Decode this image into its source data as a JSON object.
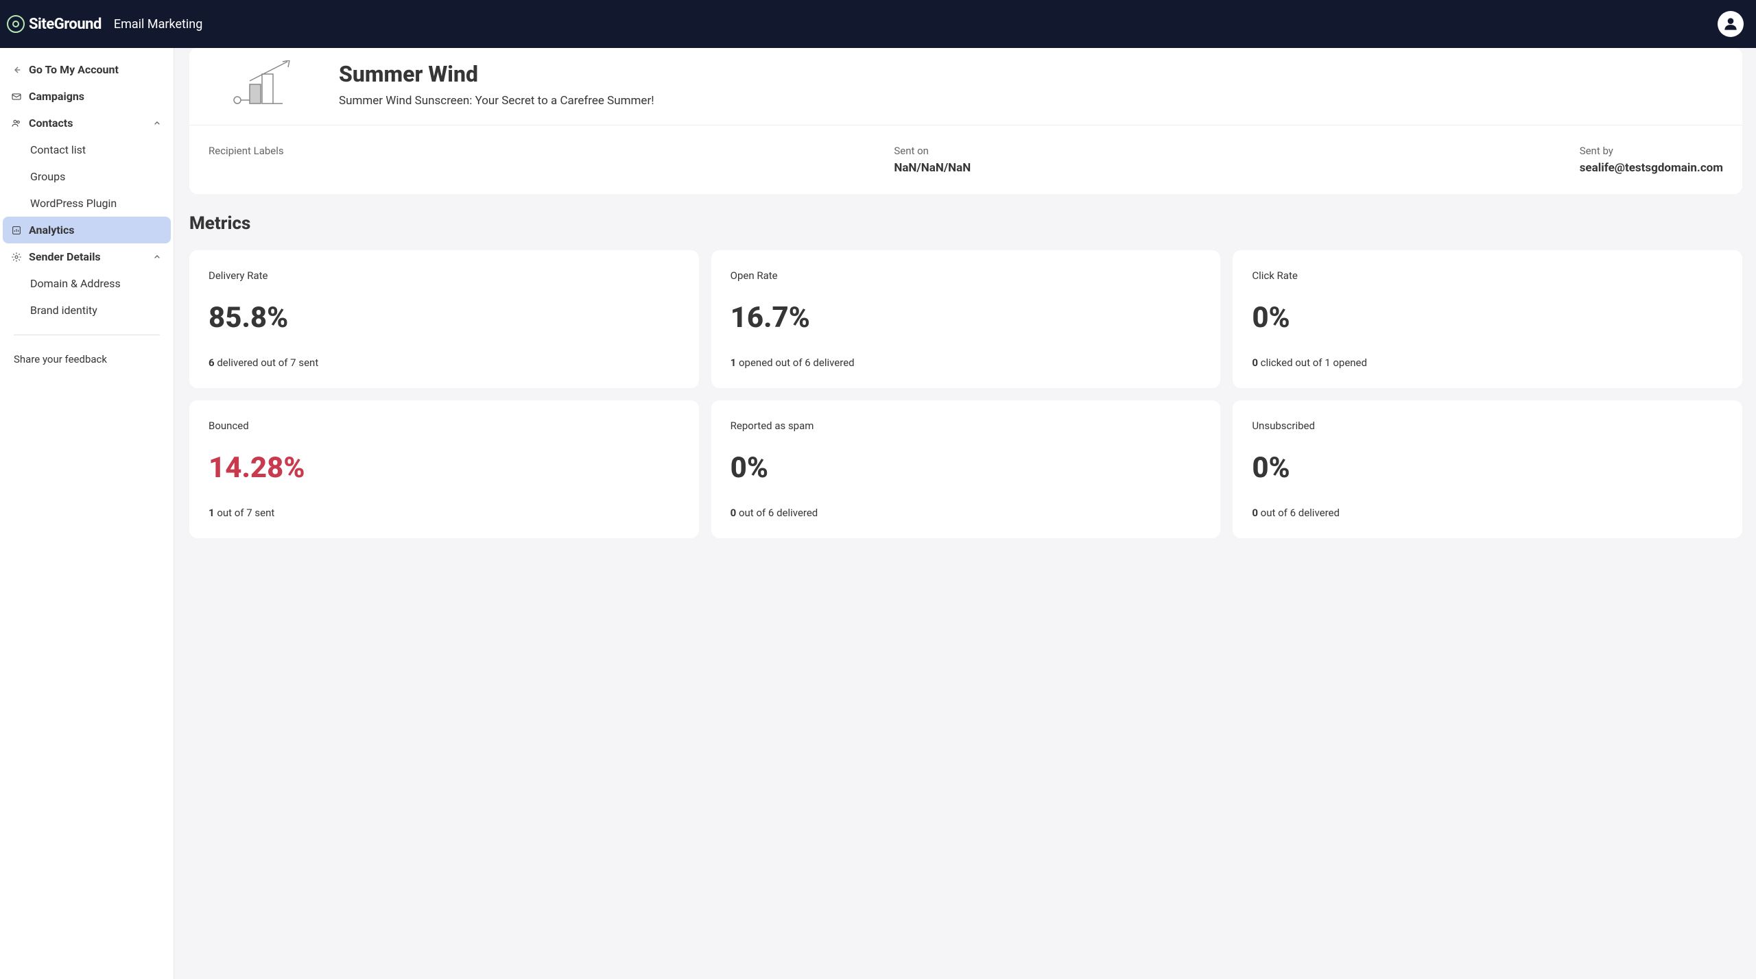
{
  "header": {
    "logo_text": "SiteGround",
    "app_name": "Email Marketing"
  },
  "sidebar": {
    "back_label": "Go To My Account",
    "campaigns": "Campaigns",
    "contacts": "Contacts",
    "contacts_items": {
      "contact_list": "Contact list",
      "groups": "Groups",
      "wp_plugin": "WordPress Plugin"
    },
    "analytics": "Analytics",
    "sender_details": "Sender Details",
    "sender_items": {
      "domain": "Domain & Address",
      "brand": "Brand identity"
    },
    "feedback": "Share your feedback"
  },
  "campaign": {
    "title": "Summer Wind",
    "subtitle": "Summer Wind Sunscreen: Your Secret to a Carefree Summer!",
    "recipient_labels_label": "Recipient Labels",
    "sent_on_label": "Sent on",
    "sent_on_value": "NaN/NaN/NaN",
    "sent_by_label": "Sent by",
    "sent_by_value": "sealife@testsgdomain.com"
  },
  "metrics": {
    "title": "Metrics",
    "cards": [
      {
        "label": "Delivery Rate",
        "value": "85.8%",
        "detail_bold": "6",
        "detail_rest": " delivered out of 7 sent",
        "red": false
      },
      {
        "label": "Open Rate",
        "value": "16.7%",
        "detail_bold": "1",
        "detail_rest": " opened out of 6 delivered",
        "red": false
      },
      {
        "label": "Click Rate",
        "value": "0%",
        "detail_bold": "0",
        "detail_rest": " clicked out of 1 opened",
        "red": false
      },
      {
        "label": "Bounced",
        "value": "14.28%",
        "detail_bold": "1",
        "detail_rest": " out of 7 sent",
        "red": true
      },
      {
        "label": "Reported as spam",
        "value": "0%",
        "detail_bold": "0",
        "detail_rest": " out of 6 delivered",
        "red": false
      },
      {
        "label": "Unsubscribed",
        "value": "0%",
        "detail_bold": "0",
        "detail_rest": " out of 6 delivered",
        "red": false
      }
    ]
  }
}
